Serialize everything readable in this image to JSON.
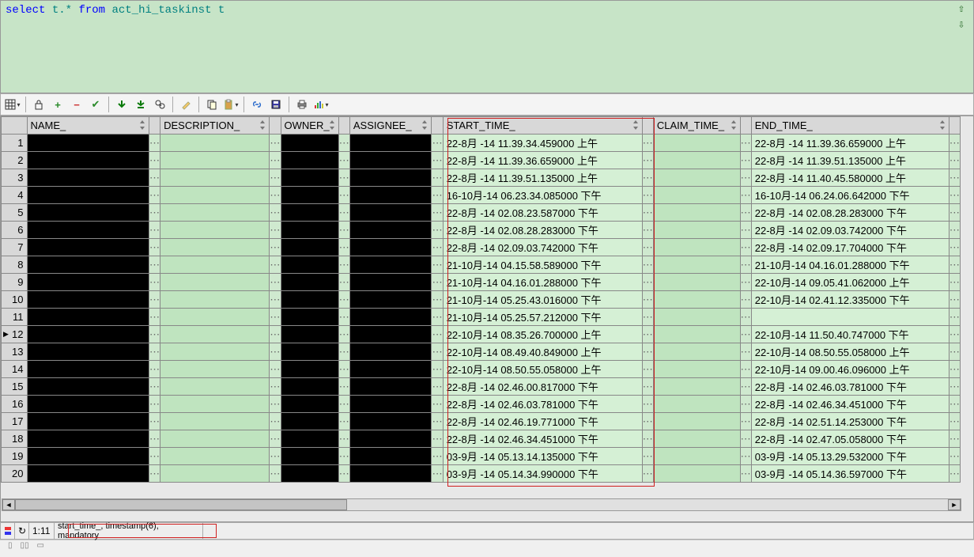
{
  "sql": {
    "keyword1": "select",
    "expr": "t.*",
    "keyword2": "from",
    "table": "act_hi_taskinst",
    "alias": "t"
  },
  "columns": {
    "name": "NAME_",
    "description": "DESCRIPTION_",
    "owner": "OWNER_",
    "assignee": "ASSIGNEE_",
    "start_time": "START_TIME_",
    "claim_time": "CLAIM_TIME_",
    "end_time": "END_TIME_"
  },
  "current_row_index": 12,
  "rows": [
    {
      "n": 1,
      "start": "22-8月 -14 11.39.34.459000 上午",
      "end": "22-8月 -14 11.39.36.659000 上午"
    },
    {
      "n": 2,
      "start": "22-8月 -14 11.39.36.659000 上午",
      "end": "22-8月 -14 11.39.51.135000 上午"
    },
    {
      "n": 3,
      "start": "22-8月 -14 11.39.51.135000 上午",
      "end": "22-8月 -14 11.40.45.580000 上午"
    },
    {
      "n": 4,
      "start": "16-10月-14 06.23.34.085000 下午",
      "end": "16-10月-14 06.24.06.642000 下午"
    },
    {
      "n": 5,
      "start": "22-8月 -14 02.08.23.587000 下午",
      "end": "22-8月 -14 02.08.28.283000 下午"
    },
    {
      "n": 6,
      "start": "22-8月 -14 02.08.28.283000 下午",
      "end": "22-8月 -14 02.09.03.742000 下午"
    },
    {
      "n": 7,
      "start": "22-8月 -14 02.09.03.742000 下午",
      "end": "22-8月 -14 02.09.17.704000 下午"
    },
    {
      "n": 8,
      "start": "21-10月-14 04.15.58.589000 下午",
      "end": "21-10月-14 04.16.01.288000 下午"
    },
    {
      "n": 9,
      "start": "21-10月-14 04.16.01.288000 下午",
      "end": "22-10月-14 09.05.41.062000 上午"
    },
    {
      "n": 10,
      "start": "21-10月-14 05.25.43.016000 下午",
      "end": "22-10月-14 02.41.12.335000 下午"
    },
    {
      "n": 11,
      "start": "21-10月-14 05.25.57.212000 下午",
      "end": ""
    },
    {
      "n": 12,
      "start": "22-10月-14 08.35.26.700000 上午",
      "end": "22-10月-14 11.50.40.747000 下午"
    },
    {
      "n": 13,
      "start": "22-10月-14 08.49.40.849000 上午",
      "end": "22-10月-14 08.50.55.058000 上午"
    },
    {
      "n": 14,
      "start": "22-10月-14 08.50.55.058000 上午",
      "end": "22-10月-14 09.00.46.096000 上午"
    },
    {
      "n": 15,
      "start": "22-8月 -14 02.46.00.817000 下午",
      "end": "22-8月 -14 02.46.03.781000 下午"
    },
    {
      "n": 16,
      "start": "22-8月 -14 02.46.03.781000 下午",
      "end": "22-8月 -14 02.46.34.451000 下午"
    },
    {
      "n": 17,
      "start": "22-8月 -14 02.46.19.771000 下午",
      "end": "22-8月 -14 02.51.14.253000 下午"
    },
    {
      "n": 18,
      "start": "22-8月 -14 02.46.34.451000 下午",
      "end": "22-8月 -14 02.47.05.058000 下午"
    },
    {
      "n": 19,
      "start": "03-9月 -14 05.13.14.135000 下午",
      "end": "03-9月 -14 05.13.29.532000 下午"
    },
    {
      "n": 20,
      "start": "03-9月 -14 05.14.34.990000 下午",
      "end": "03-9月 -14 05.14.36.597000 下午"
    }
  ],
  "status": {
    "rowcol": "1:11",
    "field_info": "start_time_, timestamp(6), mandatory"
  },
  "ellipsis": "⋯"
}
